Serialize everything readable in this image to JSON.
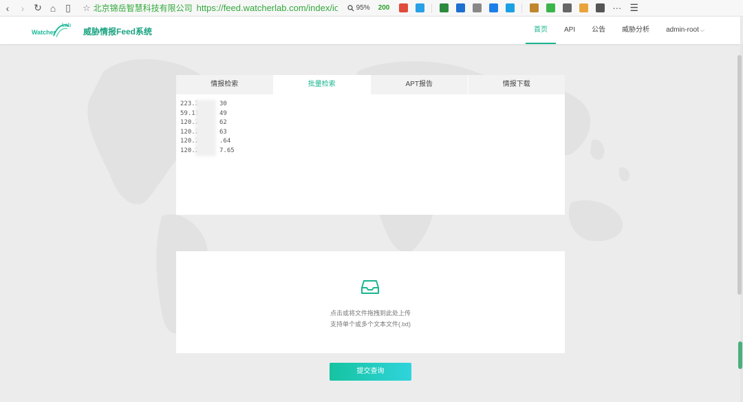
{
  "browser": {
    "back_glyph": "‹",
    "forward_glyph": "›",
    "reload_glyph": "↻",
    "home_glyph": "⌂",
    "reader_glyph": "▯",
    "star_glyph": "☆",
    "site_owner": "北京锦岳智慧科技有限公司",
    "url": "https://feed.watcherlab.com/index/ioc",
    "zoom": "95%",
    "score": "200",
    "more_glyph": "···",
    "menu_glyph": "☰",
    "extension_colors": [
      "#e04b3c",
      "#2aa0e6",
      "#2b8a3e",
      "#1f6fd1",
      "#888888",
      "#1e7ee8",
      "#1ba1e2",
      "#c0862f",
      "#3bb54a",
      "#666666",
      "#e8a43a",
      "#555555"
    ]
  },
  "header": {
    "logo_text": "Watcher",
    "logo_lab": "Lab",
    "title": "威胁情报Feed系统",
    "nav": [
      {
        "label": "首页",
        "active": true
      },
      {
        "label": "API",
        "active": false
      },
      {
        "label": "公告",
        "active": false
      },
      {
        "label": "威胁分析",
        "active": false
      },
      {
        "label": "admin-root",
        "active": false
      }
    ]
  },
  "tabs": [
    {
      "label": "情报检索",
      "active": false
    },
    {
      "label": "批量检索",
      "active": true
    },
    {
      "label": "APT报告",
      "active": false
    },
    {
      "label": "情报下载",
      "active": false
    }
  ],
  "ip_list": [
    {
      "head": "223.2",
      "tail": "30"
    },
    {
      "head": "59.11",
      "tail": "49"
    },
    {
      "head": "120.2",
      "tail": "62"
    },
    {
      "head": "120.2",
      "tail": "63"
    },
    {
      "head": "120.2",
      "tail": ".64"
    },
    {
      "head": "120.2",
      "tail": "7.65"
    }
  ],
  "upload": {
    "icon": "inbox-icon",
    "line1": "点击或将文件拖拽到此处上传",
    "line2": "支持单个或多个文本文件(.txt)"
  },
  "submit_label": "提交查询",
  "colors": {
    "accent": "#19b58f",
    "gradient_start": "#16c3a0",
    "gradient_end": "#2fd4dc"
  }
}
